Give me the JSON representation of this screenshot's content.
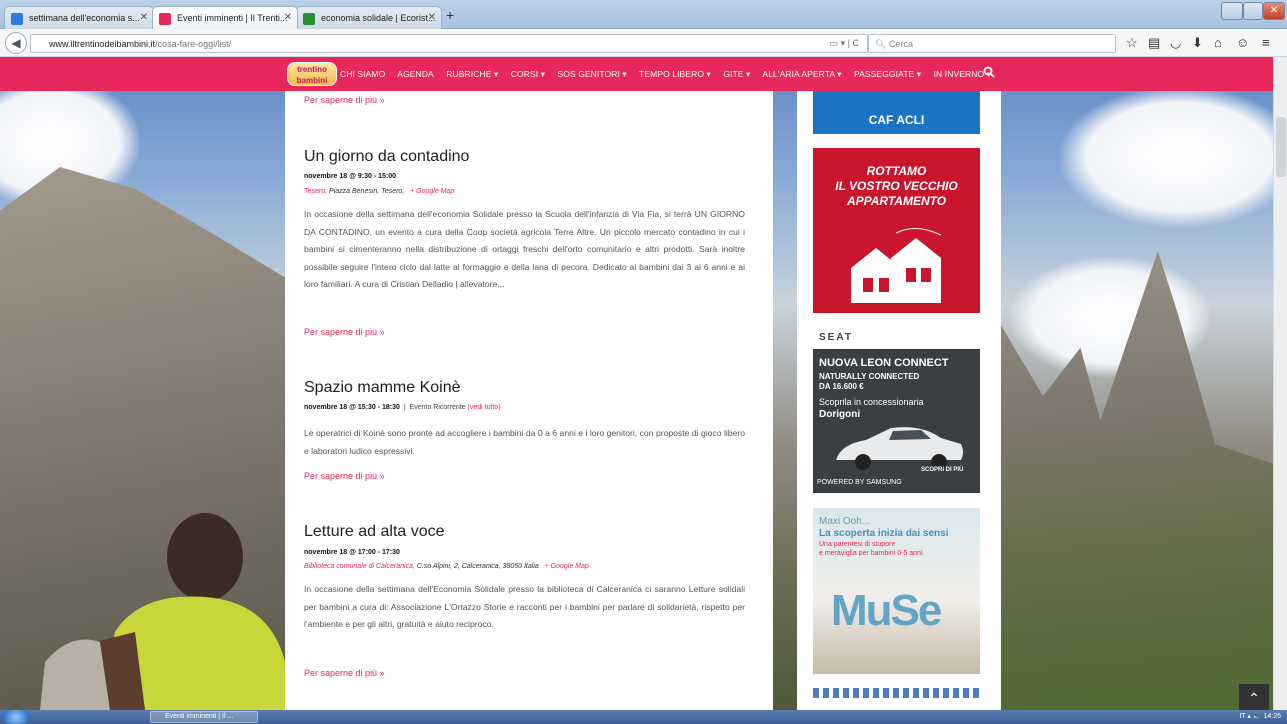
{
  "browser": {
    "tabs": [
      {
        "label": "settimana dell'economia s...",
        "color": "#2f7de1"
      },
      {
        "label": "Eventi imminenti | Il Trenti...",
        "color": "#e8275a"
      },
      {
        "label": "economia solidale | Ecorist...",
        "color": "#2e8b3a"
      }
    ],
    "new_tab": "+",
    "url_domain": "www.iltrentinodeibambini.it",
    "url_path": "/cosa-fare-oggi/list/",
    "url_icons": "▭ ▾ | C",
    "search_placeholder": "Cerca",
    "toolbar_icons": [
      "☆",
      "▤",
      "◡",
      "⬇",
      "⌂",
      "☺",
      "≡"
    ]
  },
  "site": {
    "logo_text": "trentino bambini",
    "nav": [
      "CHI SIAMO",
      "AGENDA",
      "RUBRICHE ▾",
      "CORSI ▾",
      "SOS GENITORI ▾",
      "TEMPO LIBERO ▾",
      "GITE ▾",
      "ALL'ARIA APERTA ▾",
      "PASSEGGIATE ▾",
      "IN INVERNO ▾"
    ],
    "accent": "#e8275a"
  },
  "events": [
    {
      "title": "Un giorno da contadino",
      "date": "novembre 18 @ 9:30 - 15:00",
      "venue": "Tesero,",
      "address": " Piazza Benesin, Tesero,",
      "map": "+ Google Map",
      "desc": "In occasione della settimana dell'economia Solidale presso la Scuola dell'infanzia di Via Fia, si terrà UN GIORNO DA CONTADINO, un evento a cura della Coop società agricola Terre Altre. Un piccolo mercato contadino in cui i bambini si cimenteranno nella distribuzione di ortaggi freschi dell'orto comunitario e altri prodotti. Sarà inoltre possibile seguire l'intero ciclo dal latte al formaggio e della lana di pecora. Dedicato ai bambini dai 3 ai 6 anni e ai loro familiari. A cura di Cristian Delladio | allevatore..."
    },
    {
      "title": "Spazio mamme Koinè",
      "date": "novembre 18 @ 15:30 - 18:30",
      "recurring": "Evento Ricorrente",
      "recurring_link": "(vedi tutto)",
      "desc": "Le operatrici di Koinè sono pronte ad accogliere i bambini da 0 a 6 anni e i loro genitori, con proposte di gioco libero e laboratori ludico espressivi."
    },
    {
      "title": "Letture ad alta voce",
      "date": "novembre 18 @ 17:00 - 17:30",
      "venue": "Biblioteca comunale di Calceranica,",
      "address": " C.so Alpini, 2, Calceranica, 38050 Italia",
      "map": "+ Google Map",
      "desc": "In occasione della settimana dell'Economia Solidale presso la biblioteca di Calceranica ci saranno Letture solidali per bambini a cura di: Associazione L'Ortazzo Storie e racconti per i bambini per parlare di solidarietà, rispetto per l'ambiente e per gli altri, gratuità e aiuto reciproco."
    }
  ],
  "more_label": "Per saperne di più »",
  "ads": {
    "caf": "CAF ACLI",
    "rottamo": [
      "ROTTAMO",
      "IL VOSTRO VECCHIO",
      "APPARTAMENTO"
    ],
    "seat_brand": "SEAT",
    "seat_title": "NUOVA LEON CONNECT",
    "seat_sub1": "NATURALLY CONNECTED",
    "seat_price": "DA 16.600 €",
    "seat_cta": "Scoprila in concessionaria",
    "seat_dealer": "Dorigoni",
    "seat_more": "SCOPRI DI PIÙ",
    "seat_powered": "POWERED BY SAMSUNG",
    "muse_title": "Maxi Ooh...",
    "muse_sub": "La scoperta inizia dai sensi",
    "muse_tag1": "Una parentesi di stupore",
    "muse_tag2": "e meraviglia per bambini 0-5 anni.",
    "muse_logo": "MuSe"
  },
  "taskbar": {
    "task": "Eventi imminenti | Il ...",
    "tray": "IT  ▴  🔈  14:26"
  }
}
